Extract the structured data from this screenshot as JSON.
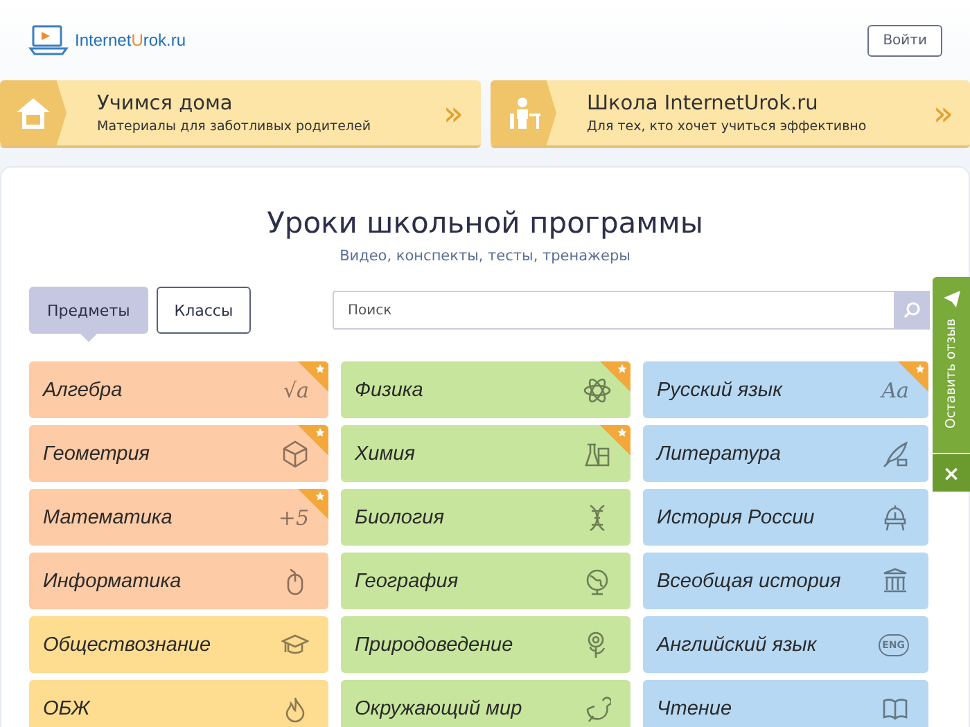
{
  "header": {
    "logo": {
      "part_1": "Internet",
      "part_2": "U",
      "part_3": "rok.ru"
    },
    "login_button": "Войти"
  },
  "banners": [
    {
      "title": "Учимся дома",
      "subtitle": "Материалы для заботливых родителей",
      "arrow": "»"
    },
    {
      "title": "Школа InternetUrok.ru",
      "subtitle": "Для тех, кто хочет учиться эффективно",
      "arrow": "»"
    }
  ],
  "main": {
    "title": "Уроки школьной программы",
    "subtitle": "Видео, конспекты, тесты, тренажеры"
  },
  "tabs": [
    {
      "label": "Предметы",
      "selected": true
    },
    {
      "label": "Классы",
      "selected": false
    }
  ],
  "search": {
    "placeholder": "Поиск"
  },
  "subjects": [
    {
      "label": "Алгебра",
      "color": "#fdcba6",
      "featured": true,
      "glyph": "√a"
    },
    {
      "label": "Физика",
      "color": "#c7e59c",
      "featured": true
    },
    {
      "label": "Русский язык",
      "color": "#b6d8f3",
      "featured": true,
      "glyph": "Aa"
    },
    {
      "label": "Геометрия",
      "color": "#fdcba6",
      "featured": true
    },
    {
      "label": "Химия",
      "color": "#c7e59c",
      "featured": true
    },
    {
      "label": "Литература",
      "color": "#b6d8f3",
      "featured": false
    },
    {
      "label": "Математика",
      "color": "#fdcba6",
      "featured": true,
      "glyph": "+5"
    },
    {
      "label": "Биология",
      "color": "#c7e59c",
      "featured": false
    },
    {
      "label": "История России",
      "color": "#b6d8f3",
      "featured": false
    },
    {
      "label": "Информатика",
      "color": "#fdcba6",
      "featured": false
    },
    {
      "label": "География",
      "color": "#c7e59c",
      "featured": false
    },
    {
      "label": "Всеобщая история",
      "color": "#b6d8f3",
      "featured": false
    },
    {
      "label": "Обществознание",
      "color": "#fedd91",
      "featured": false
    },
    {
      "label": "Природоведение",
      "color": "#c7e59c",
      "featured": false
    },
    {
      "label": "Английский язык",
      "color": "#b6d8f3",
      "featured": false,
      "glyph": "ENG"
    },
    {
      "label": "ОБЖ",
      "color": "#fedd91",
      "featured": false
    },
    {
      "label": "Окружающий мир",
      "color": "#c7e59c",
      "featured": false
    },
    {
      "label": "Чтение",
      "color": "#b6d8f3",
      "featured": false
    }
  ],
  "feedback": {
    "label": "Оставить отзыв",
    "close": "×"
  }
}
